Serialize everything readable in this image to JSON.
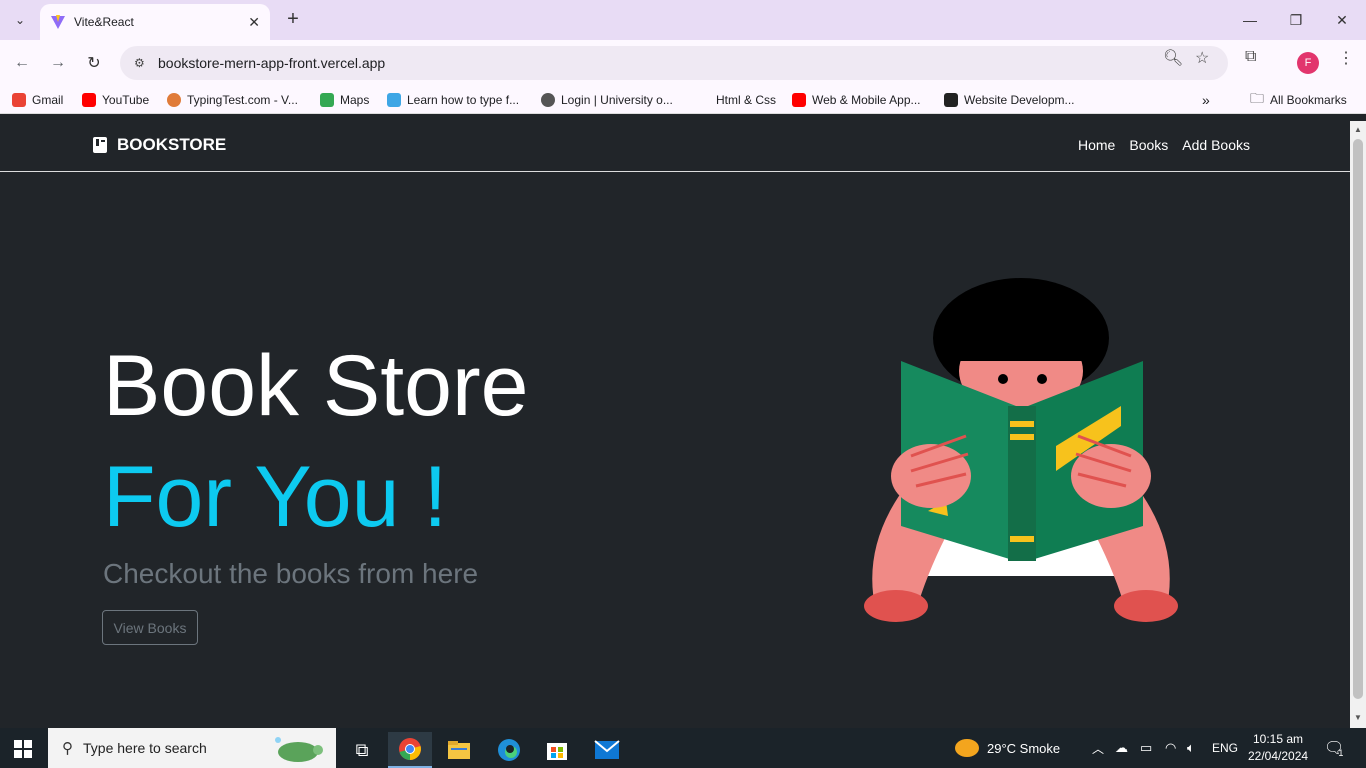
{
  "browser": {
    "tab_title": "Vite&React",
    "url": "bookstore-mern-app-front.vercel.app",
    "profile_initial": "F",
    "bookmarks": [
      {
        "label": "Gmail",
        "icon": "gmail-icon",
        "color": "#ea4335"
      },
      {
        "label": "YouTube",
        "icon": "youtube-icon",
        "color": "#ff0000"
      },
      {
        "label": "TypingTest.com - V...",
        "icon": "typingtest-icon",
        "color": "#e07b39"
      },
      {
        "label": "Maps",
        "icon": "maps-icon",
        "color": "#34a853"
      },
      {
        "label": "Learn how to type f...",
        "icon": "typing-icon",
        "color": "#3ea6e5"
      },
      {
        "label": "Login | University o...",
        "icon": "university-icon",
        "color": "#555555"
      },
      {
        "label": "Html & Css",
        "icon": "blank-icon",
        "color": "#fdf8ff"
      },
      {
        "label": "Web & Mobile App...",
        "icon": "youtube-icon",
        "color": "#ff0000"
      },
      {
        "label": "Website Developm...",
        "icon": "website-icon",
        "color": "#222222"
      }
    ],
    "all_bookmarks": "All Bookmarks"
  },
  "site": {
    "brand": "BOOKSTORE",
    "nav": [
      "Home",
      "Books",
      "Add Books"
    ],
    "hero_line1": "Book Store",
    "hero_line2": "For You !",
    "subtitle": "Checkout the books from here",
    "cta": "View Books",
    "accent_color": "#0dcaf0",
    "background": "#212529"
  },
  "taskbar": {
    "search_placeholder": "Type here to search",
    "weather": "29°C  Smoke",
    "language": "ENG",
    "time": "10:15 am",
    "date": "22/04/2024",
    "notification_count": "1"
  }
}
